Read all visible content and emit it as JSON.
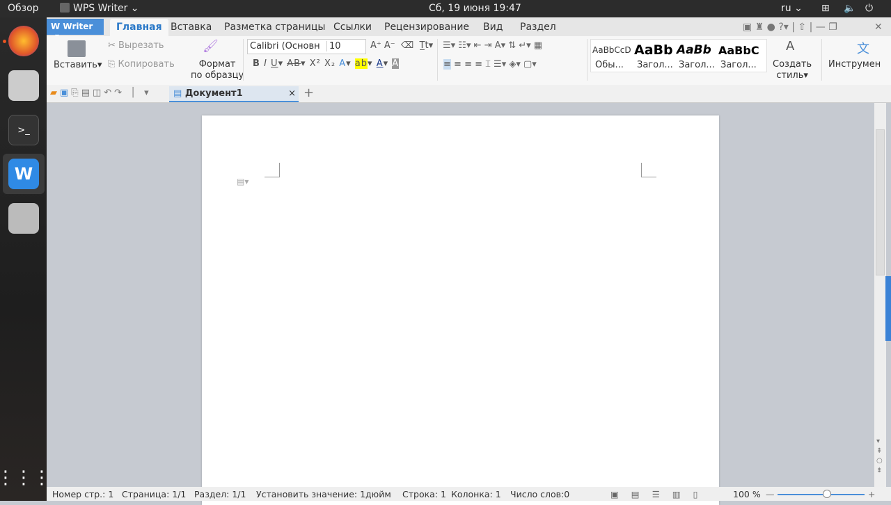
{
  "topbar": {
    "overview": "Обзор",
    "app": "WPS Writer ⌄",
    "clock": "Сб, 19 июня  19:47",
    "lang": "ru ⌄"
  },
  "menu": {
    "writer": "Writer",
    "tabs": [
      "Главная",
      "Вставка",
      "Разметка страницы",
      "Ссылки",
      "Рецензирование",
      "Вид",
      "Раздел"
    ]
  },
  "ribbon": {
    "paste": "Вставить",
    "cut": "Вырезать",
    "copy": "Копировать",
    "format1": "Формат",
    "format2": "по образцу",
    "font": "Calibri (Основн",
    "size": "10",
    "styles": [
      "Обы...",
      "Загол...",
      "Загол...",
      "Загол..."
    ],
    "style_previews": [
      "AaBbCcD",
      "AaBb",
      "AaBb",
      "AaBbC"
    ],
    "create1": "Создать",
    "create2": "стиль",
    "tools": "Инструмен"
  },
  "doc": {
    "tab": "Документ1"
  },
  "status": {
    "page_no": "Номер стр.: 1",
    "page": "Страница: 1/1",
    "section": "Раздел: 1/1",
    "set": "Установить значение: 1дюйм",
    "row": "Строка: 1",
    "col": "Колонка: 1",
    "words": "Число слов:0",
    "zoom": "100 %"
  },
  "zoom_fraction": 0.5
}
